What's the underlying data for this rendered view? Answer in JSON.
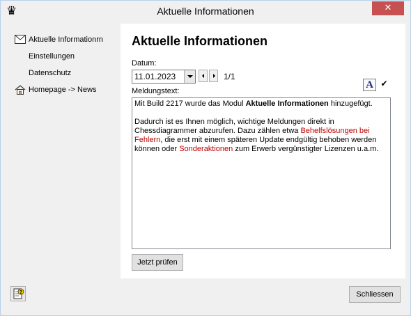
{
  "window": {
    "title": "Aktuelle Informationen",
    "app_icon": "chess-queen-icon",
    "close_glyph": "✕"
  },
  "sidebar": {
    "items": [
      {
        "label": "Aktuelle Informationrn",
        "icon": "envelope-icon"
      },
      {
        "label": "Einstellungen",
        "icon": ""
      },
      {
        "label": "Datenschutz",
        "icon": ""
      },
      {
        "label": "Homepage -> News",
        "icon": "home-icon"
      }
    ]
  },
  "main": {
    "heading": "Aktuelle Informationen",
    "date_label": "Datum:",
    "date_value": "11.01.2023",
    "page_counter": "1/1",
    "message_label": "Meldungstext:",
    "font_button_glyph": "A",
    "check_button_glyph": "✔",
    "message": {
      "p1_pre": "Mit Build 2217 wurde das Modul ",
      "p1_bold": "Aktuelle Informationen",
      "p1_post": " hinzugefügt.",
      "p2_a": "Dadurch ist es Ihnen möglich, wichtige Meldungen direkt in Chessdiagrammer abzurufen. Dazu zählen etwa ",
      "p2_red1": "Behelfslösungen bei Fehlern",
      "p2_b": ", die erst mit einem späteren Update endgültig behoben werden können oder ",
      "p2_red2": "Sonderaktionen",
      "p2_c": " zum Erwerb vergünstigter Lizenzen u.a.m."
    },
    "check_button": "Jetzt prüfen"
  },
  "footer": {
    "close_button": "Schliessen",
    "help_icon": "help-icon"
  },
  "colors": {
    "highlight_red": "#c00000",
    "font_button_blue": "#1c2f8c"
  }
}
